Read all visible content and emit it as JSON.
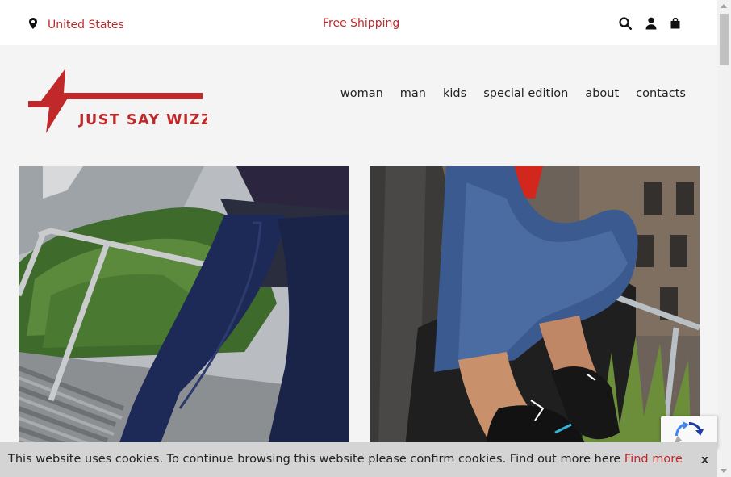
{
  "topbar": {
    "location_label": "United States",
    "shipping_text": "Free Shipping",
    "icons": [
      "search-icon",
      "user-icon",
      "cart-icon"
    ]
  },
  "brand": {
    "name": "JUST SAY WIZZ",
    "color": "#c0282a"
  },
  "nav": {
    "items": [
      {
        "label": "woman"
      },
      {
        "label": "man"
      },
      {
        "label": "kids"
      },
      {
        "label": "special edition"
      },
      {
        "label": "about"
      },
      {
        "label": "contacts"
      }
    ]
  },
  "cookie": {
    "message": "This website uses cookies. To continue browsing this website please confirm cookies. Find out more here",
    "link_label": "Find more",
    "close_label": "x"
  },
  "colors": {
    "accent": "#c0282a",
    "header_bg": "#f4f4f4",
    "cookie_bg": "#d4d4d4"
  }
}
